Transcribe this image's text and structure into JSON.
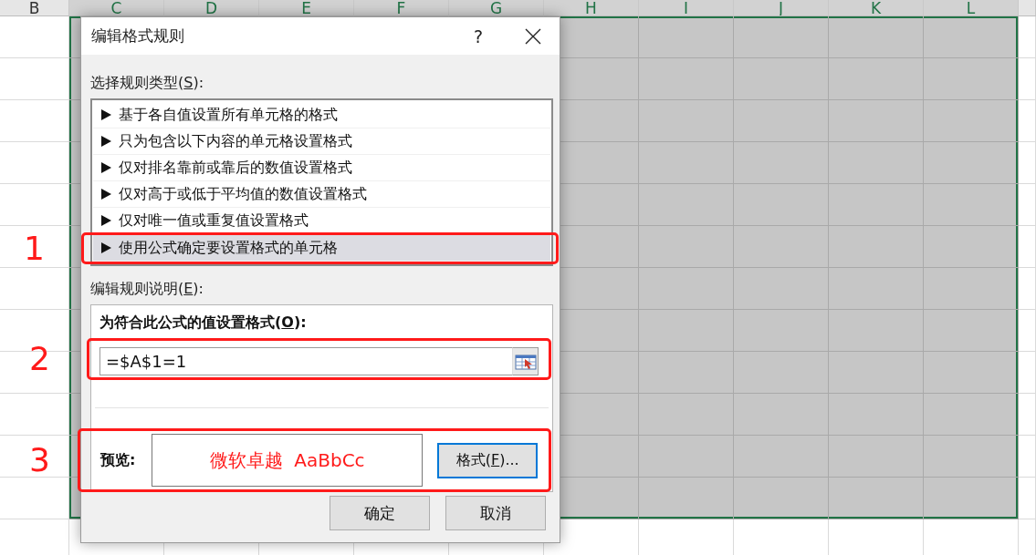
{
  "sheet": {
    "columns": [
      {
        "label": "B",
        "selected": false
      },
      {
        "label": "C",
        "selected": true
      },
      {
        "label": "D",
        "selected": true
      },
      {
        "label": "E",
        "selected": true
      },
      {
        "label": "F",
        "selected": true
      },
      {
        "label": "G",
        "selected": true
      },
      {
        "label": "H",
        "selected": true
      },
      {
        "label": "I",
        "selected": true
      },
      {
        "label": "J",
        "selected": true
      },
      {
        "label": "K",
        "selected": true
      },
      {
        "label": "L",
        "selected": true
      }
    ],
    "rows": [
      {
        "selected": true
      },
      {
        "selected": true
      },
      {
        "selected": true
      },
      {
        "selected": true
      },
      {
        "selected": true
      },
      {
        "selected": true
      },
      {
        "selected": true
      },
      {
        "selected": true
      },
      {
        "selected": true
      },
      {
        "selected": true
      },
      {
        "selected": true
      },
      {
        "selected": true
      }
    ]
  },
  "dialog": {
    "title": "编辑格式规则",
    "help": "?",
    "rule_type_label": {
      "before": "选择规则类型(",
      "key": "S",
      "after": "):"
    },
    "rule_types": [
      {
        "label": "基于各自值设置所有单元格的格式",
        "selected": false
      },
      {
        "label": "只为包含以下内容的单元格设置格式",
        "selected": false
      },
      {
        "label": "仅对排名靠前或靠后的数值设置格式",
        "selected": false
      },
      {
        "label": "仅对高于或低于平均值的数值设置格式",
        "selected": false
      },
      {
        "label": "仅对唯一值或重复值设置格式",
        "selected": false
      },
      {
        "label": "使用公式确定要设置格式的单元格",
        "selected": true,
        "annotation": "1"
      }
    ],
    "description_label": {
      "before": "编辑规则说明(",
      "key": "E",
      "after": "):"
    },
    "formula_label": {
      "before": "为符合此公式的值设置格式(",
      "key": "O",
      "after": "):"
    },
    "formula": {
      "value": "=$A$1=1",
      "annotation": "2"
    },
    "preview": {
      "label": "预览:",
      "text": "微软卓越  AaBbCc",
      "annotation": "3"
    },
    "format_button": {
      "before": "格式(",
      "key": "F",
      "after": ")...",
      "focused": true
    },
    "buttons": [
      "确定",
      "取消"
    ]
  }
}
